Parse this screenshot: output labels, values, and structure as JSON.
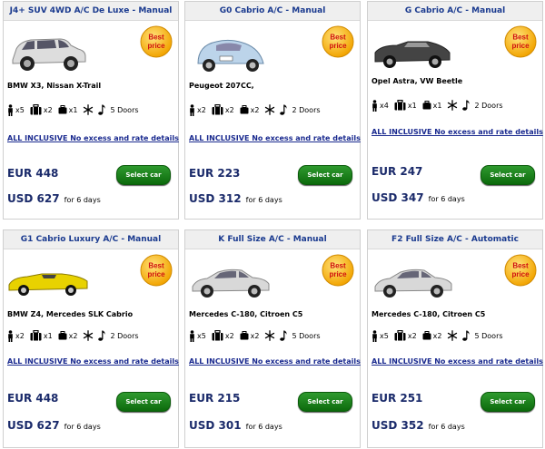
{
  "badge_text": [
    "Best",
    "price"
  ],
  "colors": {
    "title": "#1a3a8f",
    "button": "#1a8a1a",
    "badge": "#f2b400",
    "link": "#1a2a8f"
  },
  "icons": [
    "person-icon",
    "suitcase-icon",
    "bag-icon",
    "snowflake-icon",
    "music-note-icon"
  ],
  "cars": [
    {
      "title": "J4+ SUV 4WD A/C De Luxe - Manual",
      "models": "BMW X3, Nissan X-Trail",
      "persons": "x5",
      "suitcases": "x2",
      "bags": "x1",
      "doors": "5 Doors",
      "inclusive": "ALL INCLUSIVE No excess and rate details",
      "eur": "EUR 448",
      "usd": "USD 627",
      "usd_for": "for 6 days",
      "button": "Select car",
      "car_color": "#ddd",
      "car_type": "suv"
    },
    {
      "title": "G0 Cabrio A/C - Manual",
      "models": "Peugeot 207CC,",
      "persons": "x2",
      "suitcases": "x2",
      "bags": "x2",
      "doors": "2 Doors",
      "inclusive": "ALL INCLUSIVE No excess and rate details",
      "eur": "EUR 223",
      "usd": "USD 312",
      "usd_for": "for 6 days",
      "button": "Select car",
      "car_color": "#bcd4ea",
      "car_type": "beetle"
    },
    {
      "title": "G Cabrio A/C - Manual",
      "models": "Opel Astra, VW Beetle",
      "persons": "x4",
      "suitcases": "x1",
      "bags": "x1",
      "doors": "2 Doors",
      "inclusive": "ALL INCLUSIVE No excess and rate details",
      "eur": "EUR 247",
      "usd": "USD 347",
      "usd_for": "for 6 days",
      "button": "Select car",
      "car_color": "#444",
      "car_type": "cabrio"
    },
    {
      "title": "G1 Cabrio Luxury A/C - Manual",
      "models": "BMW Z4, Mercedes SLK Cabrio",
      "persons": "x2",
      "suitcases": "x1",
      "bags": "x2",
      "doors": "2 Doors",
      "inclusive": "ALL INCLUSIVE No excess and rate details",
      "eur": "EUR 448",
      "usd": "USD 627",
      "usd_for": "for 6 days",
      "button": "Select car",
      "car_color": "#e8d200",
      "car_type": "roadster"
    },
    {
      "title": "K Full Size A/C - Manual",
      "models": "Mercedes C-180, Citroen C5",
      "persons": "x5",
      "suitcases": "x2",
      "bags": "x2",
      "doors": "5 Doors",
      "inclusive": "ALL INCLUSIVE No excess and rate details",
      "eur": "EUR 215",
      "usd": "USD 301",
      "usd_for": "for 6 days",
      "button": "Select car",
      "car_color": "#d8d8d8",
      "car_type": "sedan"
    },
    {
      "title": "F2 Full Size A/C - Automatic",
      "models": "Mercedes C-180, Citroen C5",
      "persons": "x5",
      "suitcases": "x2",
      "bags": "x2",
      "doors": "5 Doors",
      "inclusive": "ALL INCLUSIVE No excess and rate details",
      "eur": "EUR 251",
      "usd": "USD 352",
      "usd_for": "for 6 days",
      "button": "Select car",
      "car_color": "#d8d8d8",
      "car_type": "sedan"
    }
  ]
}
